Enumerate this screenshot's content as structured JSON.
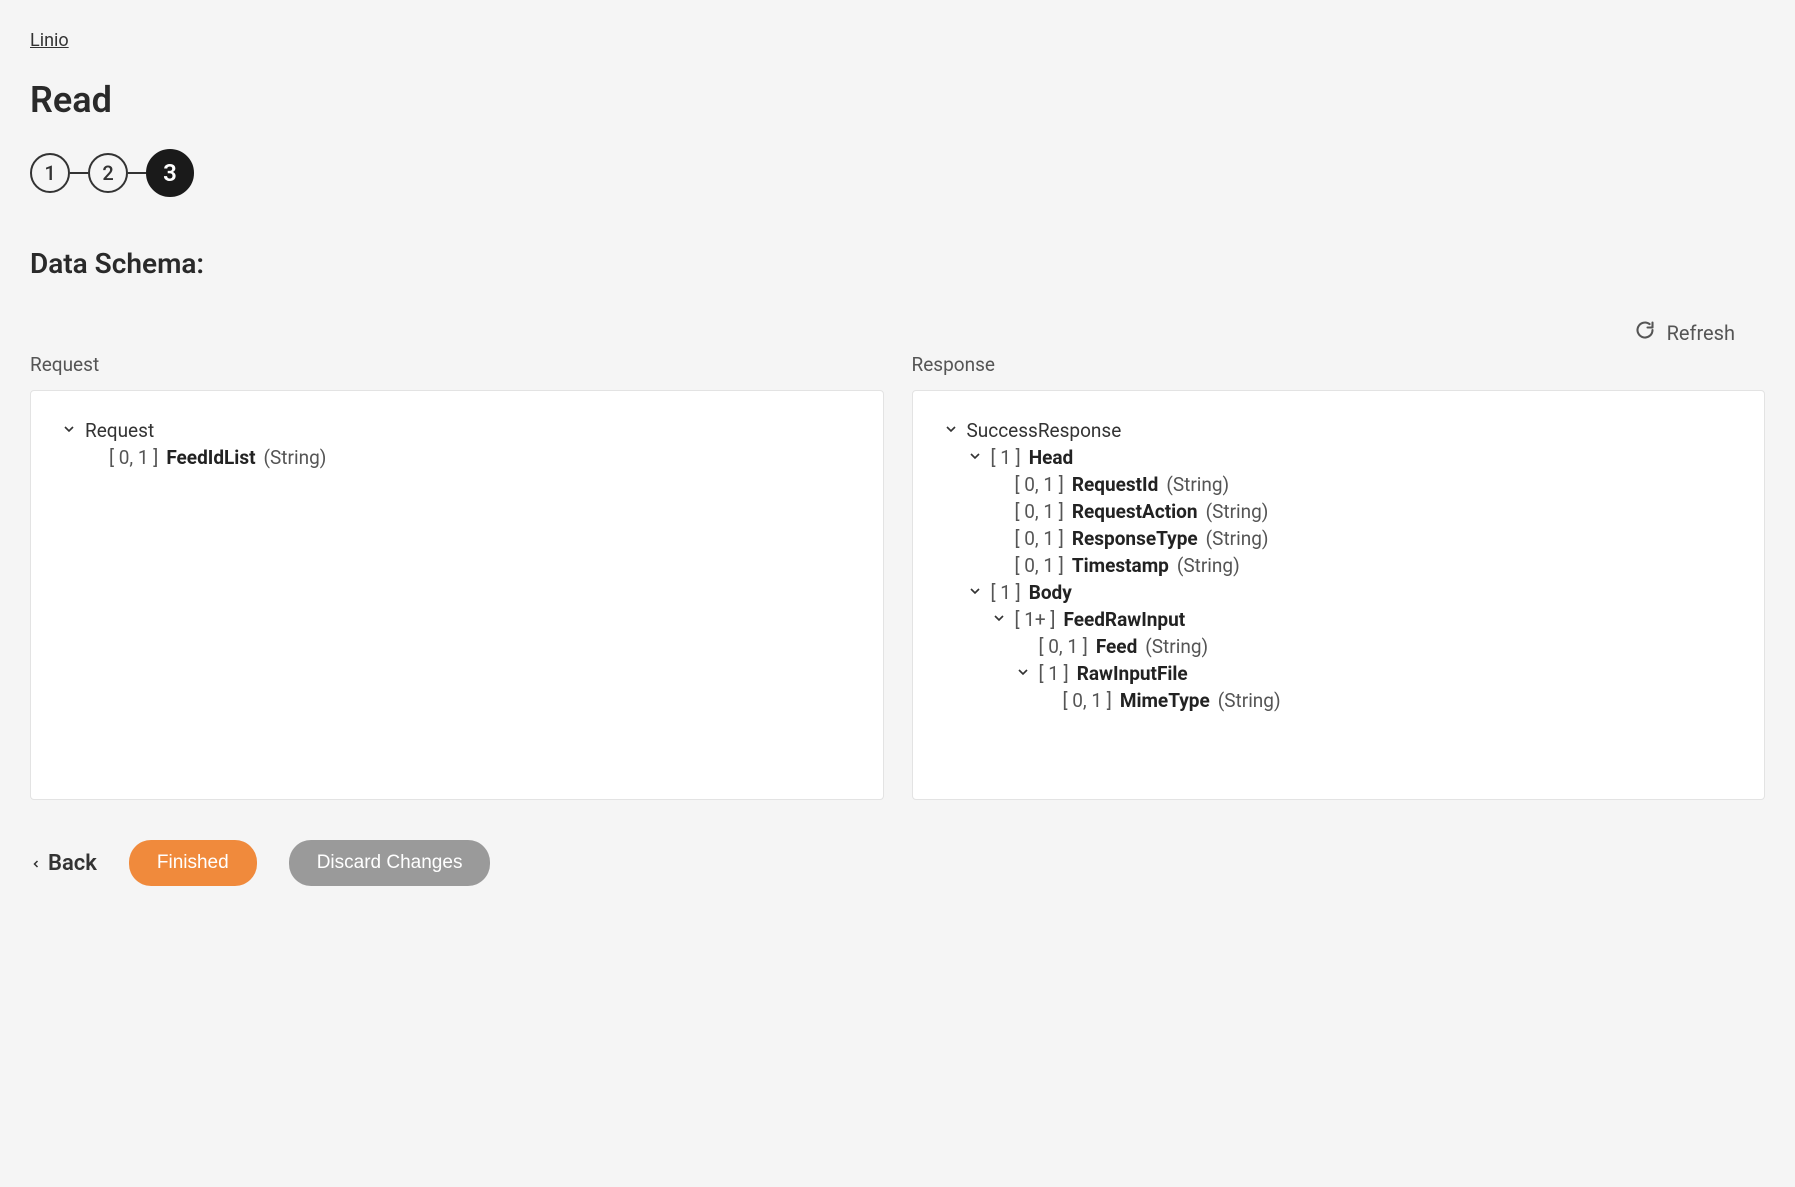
{
  "breadcrumb": "Linio",
  "title": "Read",
  "stepper": {
    "steps": [
      "1",
      "2",
      "3"
    ],
    "activeIndex": 2
  },
  "sectionTitle": "Data Schema:",
  "refreshLabel": "Refresh",
  "panels": {
    "request": {
      "label": "Request",
      "root": "Request",
      "items": [
        {
          "card": "[ 0, 1 ]",
          "name": "FeedIdList",
          "type": "(String)"
        }
      ]
    },
    "response": {
      "label": "Response",
      "root": "SuccessResponse",
      "head": {
        "card": "[ 1 ]",
        "name": "Head",
        "items": [
          {
            "card": "[ 0, 1 ]",
            "name": "RequestId",
            "type": "(String)"
          },
          {
            "card": "[ 0, 1 ]",
            "name": "RequestAction",
            "type": "(String)"
          },
          {
            "card": "[ 0, 1 ]",
            "name": "ResponseType",
            "type": "(String)"
          },
          {
            "card": "[ 0, 1 ]",
            "name": "Timestamp",
            "type": "(String)"
          }
        ]
      },
      "body": {
        "card": "[ 1 ]",
        "name": "Body",
        "feedRawInput": {
          "card": "[ 1+ ]",
          "name": "FeedRawInput",
          "feed": {
            "card": "[ 0, 1 ]",
            "name": "Feed",
            "type": "(String)"
          },
          "rawInputFile": {
            "card": "[ 1 ]",
            "name": "RawInputFile",
            "mimeType": {
              "card": "[ 0, 1 ]",
              "name": "MimeType",
              "type": "(String)"
            }
          }
        }
      }
    }
  },
  "footer": {
    "back": "Back",
    "finished": "Finished",
    "discard": "Discard Changes"
  }
}
